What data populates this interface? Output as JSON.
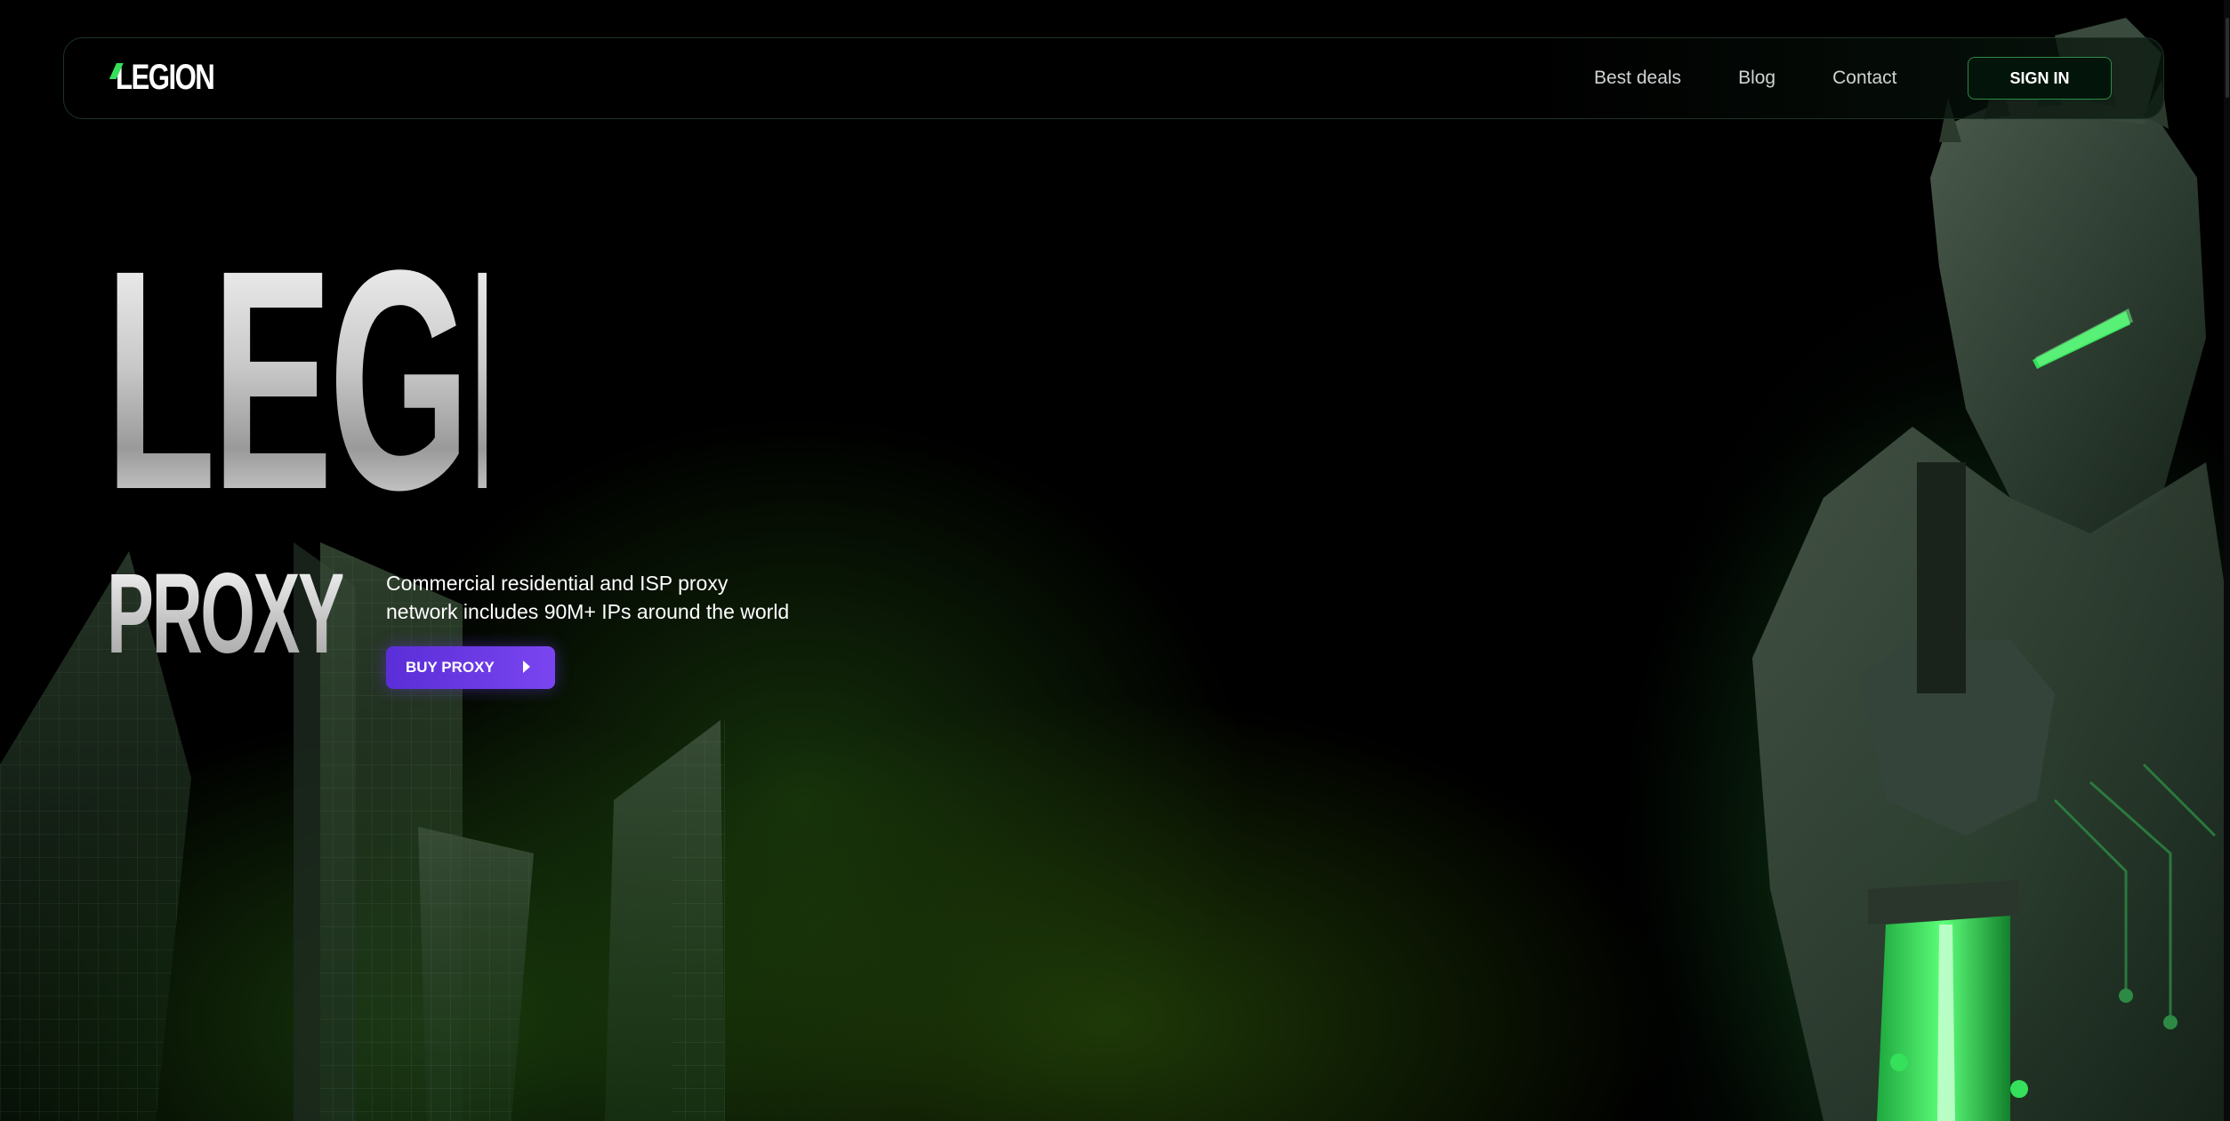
{
  "brand": {
    "logo_text": "LEGION"
  },
  "nav": {
    "links": [
      {
        "label": "Best deals"
      },
      {
        "label": "Blog"
      },
      {
        "label": "Contact"
      }
    ],
    "signin_label": "SIGN IN"
  },
  "hero": {
    "title": "LEGION",
    "subtitle": "PROXY",
    "description_line1": "Commercial residential and ISP proxy",
    "description_line2": "network includes 90M+ IPs around the world",
    "cta_label": "BUY PROXY"
  },
  "colors": {
    "accent_green": "#35e05a",
    "cta_purple": "#6a38e8",
    "background": "#000000"
  },
  "icons": [
    "play-arrow-icon",
    "knight-illustration",
    "city-buildings-illustration"
  ]
}
